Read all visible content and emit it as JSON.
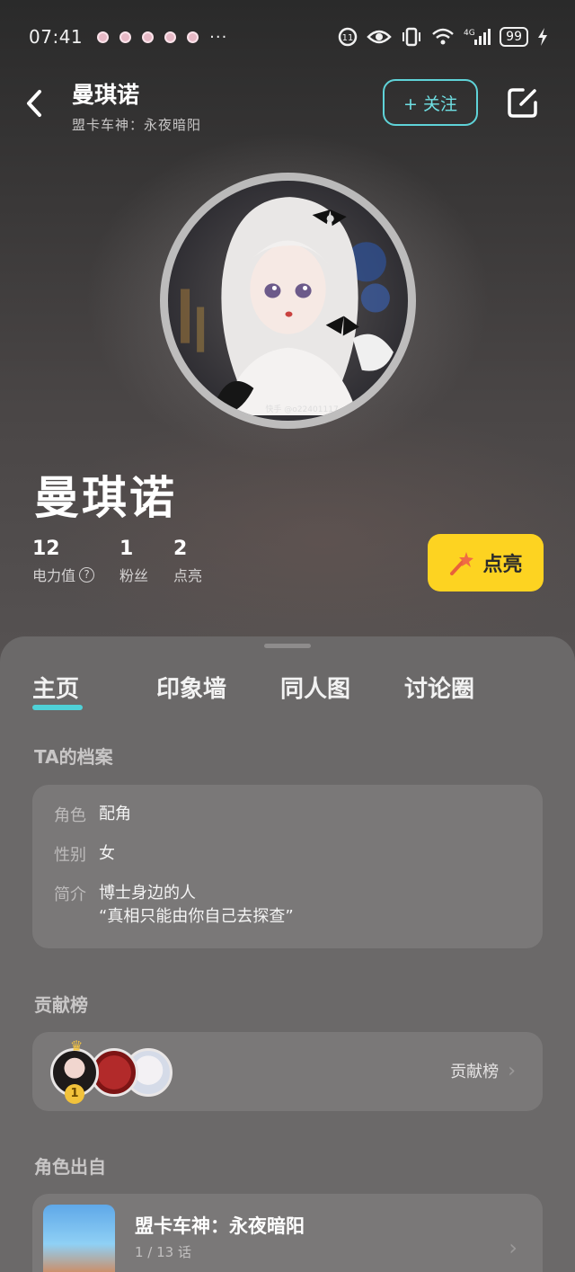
{
  "status_bar": {
    "time": "07:41",
    "more": "···",
    "battery": "99",
    "network": "4G"
  },
  "header": {
    "title": "曼琪诺",
    "subtitle": "盟卡车神：永夜暗阳",
    "follow_label": "+ 关注"
  },
  "profile": {
    "name": "曼琪诺",
    "avatar_watermark": "快手 @o22401117",
    "stats": [
      {
        "value": "12",
        "label": "电力值"
      },
      {
        "value": "1",
        "label": "粉丝"
      },
      {
        "value": "2",
        "label": "点亮"
      }
    ],
    "light_button": "点亮"
  },
  "tabs": [
    "主页",
    "印象墙",
    "同人图",
    "讨论圈"
  ],
  "archive": {
    "section_title": "TA的档案",
    "rows": [
      {
        "key": "角色",
        "value": "配角"
      },
      {
        "key": "性别",
        "value": "女"
      },
      {
        "key": "简介",
        "value": "博士身边的人",
        "value2": "“真相只能由你自己去探查”"
      }
    ]
  },
  "contrib": {
    "section_title": "贡献榜",
    "link_label": "贡献榜",
    "rank": "1"
  },
  "origin": {
    "section_title": "角色出自",
    "title": "盟卡车神：永夜暗阳",
    "subtitle": "1 / 13 话"
  },
  "colors": {
    "accent": "#4fd1d7",
    "light_button": "#fdd321",
    "sheet": "#6b6969"
  }
}
